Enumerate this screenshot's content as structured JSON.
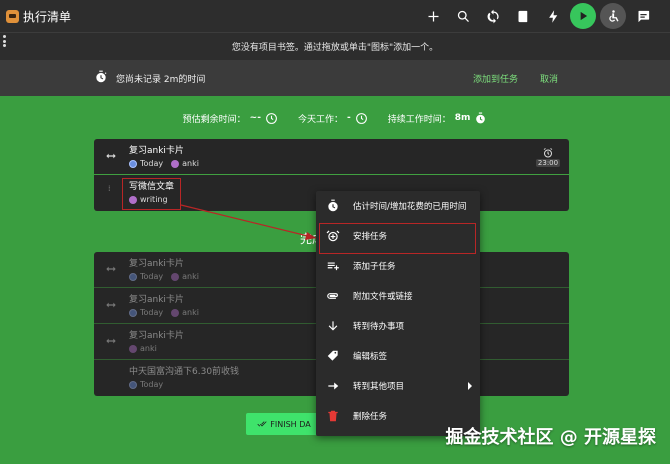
{
  "app": {
    "title": "执行清单"
  },
  "toolbar": {
    "icons": [
      "plus-icon",
      "search-icon",
      "sync-icon",
      "book-icon",
      "bolt-icon",
      "play-icon",
      "accessible-icon",
      "chat-icon"
    ],
    "play_color": "#37c65c"
  },
  "bookmark_bar": {
    "message": "您没有项目书签。通过拖放或单击\"图标\"添加一个。"
  },
  "record_bar": {
    "message": "您尚未记录 2m的时间",
    "add_label": "添加到任务",
    "cancel_label": "取消"
  },
  "stats": {
    "estimate_label": "预估剩余时间：",
    "estimate_value": "~-",
    "today_label": "今天工作：",
    "today_value": "-",
    "continuous_label": "持续工作时间：",
    "continuous_value": "8m"
  },
  "active_tasks": [
    {
      "title": "复习anki卡片",
      "tags": [
        {
          "type": "today",
          "label": "Today"
        },
        {
          "type": "tag",
          "label": "anki"
        }
      ],
      "alarm": "23:00"
    },
    {
      "title": "写微信文章",
      "tags": [
        {
          "type": "tag",
          "label": "writing"
        }
      ]
    }
  ],
  "done_heading": "完成",
  "done_tasks": [
    {
      "title": "复习anki卡片",
      "tags": [
        {
          "type": "today",
          "label": "Today"
        },
        {
          "type": "tag",
          "label": "anki"
        }
      ]
    },
    {
      "title": "复习anki卡片",
      "tags": [
        {
          "type": "today",
          "label": "Today"
        },
        {
          "type": "tag",
          "label": "anki"
        }
      ]
    },
    {
      "title": "复习anki卡片",
      "tags": [
        {
          "type": "tag",
          "label": "anki"
        }
      ]
    },
    {
      "title": "中天国富沟通下6.30前收钱",
      "tags": [
        {
          "type": "today",
          "label": "Today"
        }
      ]
    }
  ],
  "finish_button": {
    "label": "FINISH DA"
  },
  "context_menu": {
    "items": [
      {
        "label": "估计时间/增加花费的已用时间",
        "icon": "stopwatch-icon"
      },
      {
        "label": "安排任务",
        "icon": "alarm-add-icon"
      },
      {
        "label": "添加子任务",
        "icon": "playlist-add-icon"
      },
      {
        "label": "附加文件或链接",
        "icon": "attachment-icon"
      },
      {
        "label": "转到待办事项",
        "icon": "arrow-down-icon"
      },
      {
        "label": "编辑标签",
        "icon": "tag-edit-icon"
      },
      {
        "label": "转到其他项目",
        "icon": "forward-icon"
      },
      {
        "label": "删除任务",
        "icon": "delete-icon"
      }
    ]
  },
  "highlight_color": "#b82626",
  "accent_green": "#3a9e40",
  "watermark": "掘金技术社区 @ 开源星探"
}
